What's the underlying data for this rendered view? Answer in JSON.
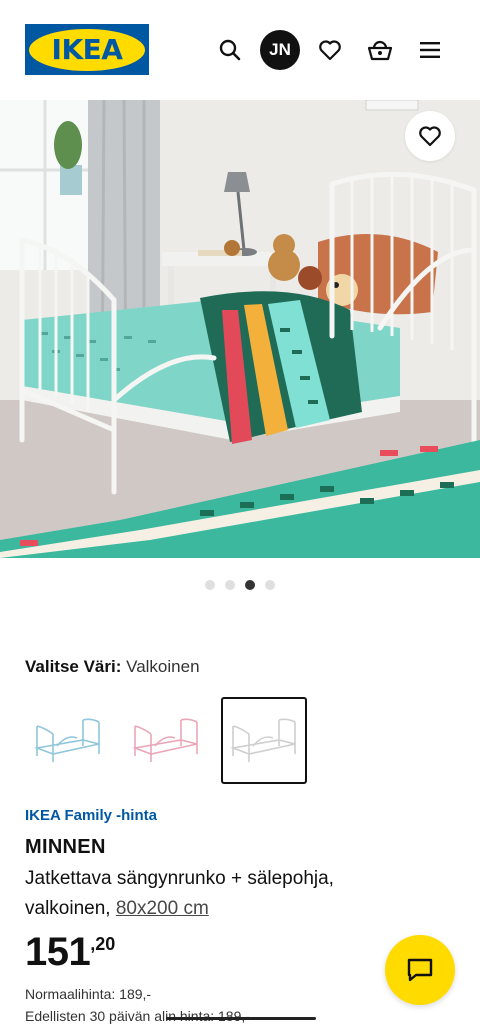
{
  "header": {
    "logo_text": "IKEA",
    "user_initials": "JN",
    "icons": [
      "search-icon",
      "heart-icon",
      "basket-icon",
      "menu-icon"
    ]
  },
  "gallery": {
    "image_count": 4,
    "active_index": 2
  },
  "color_selector": {
    "label": "Valitse Väri:",
    "selected_value": "Valkoinen",
    "swatches": [
      {
        "name": "light-blue",
        "color": "#8fc6d9"
      },
      {
        "name": "pink",
        "color": "#e9a7b8"
      },
      {
        "name": "white",
        "color": "#d8d8d8",
        "selected": true
      }
    ]
  },
  "product": {
    "family_label": "IKEA Family -hinta",
    "name": "MINNEN",
    "description": "Jatkettava sängynrunko + sälepohja, valkoinen,",
    "size": "80x200 cm",
    "price_integer": "151",
    "price_decimal": ",20",
    "normal_price": "Normaalihinta: 189,-",
    "last30_prefix": "Edellisten 30 päivän",
    "last30_strike": " alin hinta: 189,-"
  },
  "colors": {
    "brand_blue": "#0058a3",
    "brand_yellow": "#ffdb00"
  }
}
